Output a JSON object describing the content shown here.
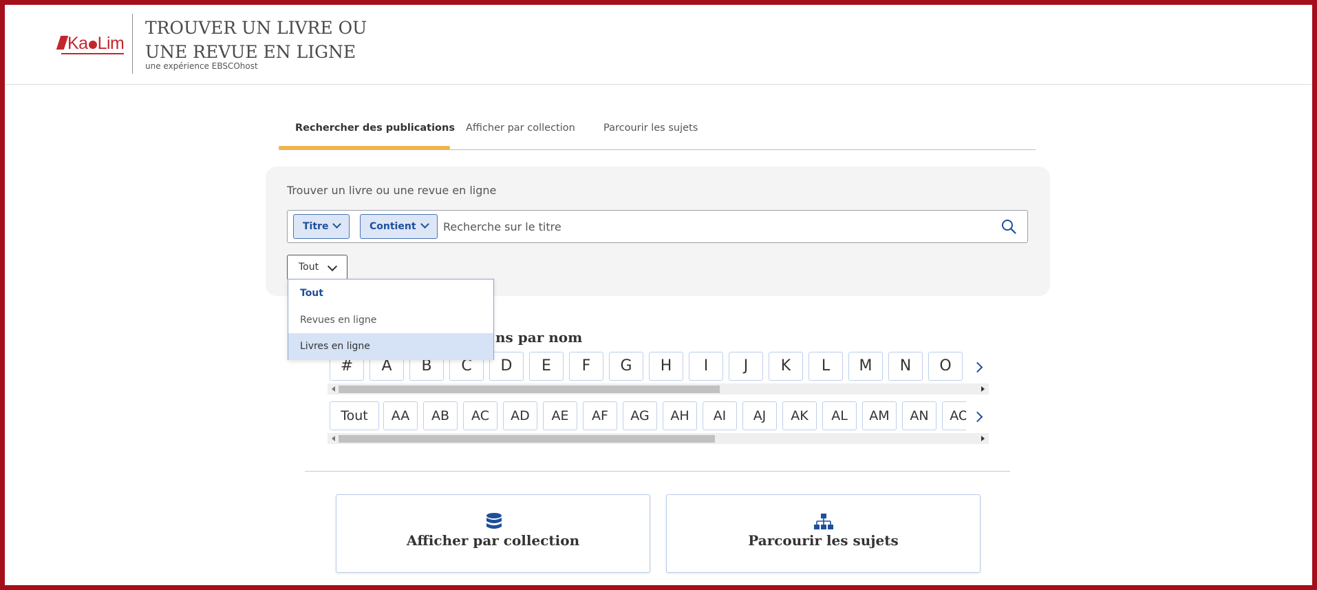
{
  "colors": {
    "frame": "#a50e1b",
    "brand": "#c4262e",
    "accent_tab": "#f0b44c",
    "link_blue": "#1e4f9c",
    "pill_bg": "#dde6f6",
    "panel_bg": "#f4f4f4"
  },
  "header": {
    "logo_text": "KaoLim",
    "title_line1": "TROUVER UN LIVRE OU",
    "title_line2": "UNE REVUE EN LIGNE",
    "subtitle": "une expérience EBSCOhost"
  },
  "tabs": [
    {
      "label": "Rechercher des publications",
      "active": true
    },
    {
      "label": "Afficher par collection",
      "active": false
    },
    {
      "label": "Parcourir les sujets",
      "active": false
    }
  ],
  "search": {
    "label": "Trouver un livre ou une revue en ligne",
    "field_pill": "Titre",
    "operator_pill": "Contient",
    "placeholder": "Recherche sur le titre",
    "icon": "search-icon"
  },
  "filter": {
    "selected": "Tout",
    "options": [
      "Tout",
      "Revues en ligne",
      "Livres en ligne"
    ],
    "highlighted_option": "Livres en ligne"
  },
  "browse": {
    "title_visible": "ns par nom",
    "letters": [
      "#",
      "A",
      "B",
      "C",
      "D",
      "E",
      "F",
      "G",
      "H",
      "I",
      "J",
      "K",
      "L",
      "M",
      "N",
      "O"
    ],
    "pairs": [
      "Tout",
      "AA",
      "AB",
      "AC",
      "AD",
      "AE",
      "AF",
      "AG",
      "AH",
      "AI",
      "AJ",
      "AK",
      "AL",
      "AM",
      "AN",
      "AO"
    ],
    "scroll_position": 0.0
  },
  "cards": [
    {
      "label": "Afficher par collection",
      "icon": "database-icon"
    },
    {
      "label": "Parcourir les sujets",
      "icon": "sitemap-icon"
    }
  ]
}
